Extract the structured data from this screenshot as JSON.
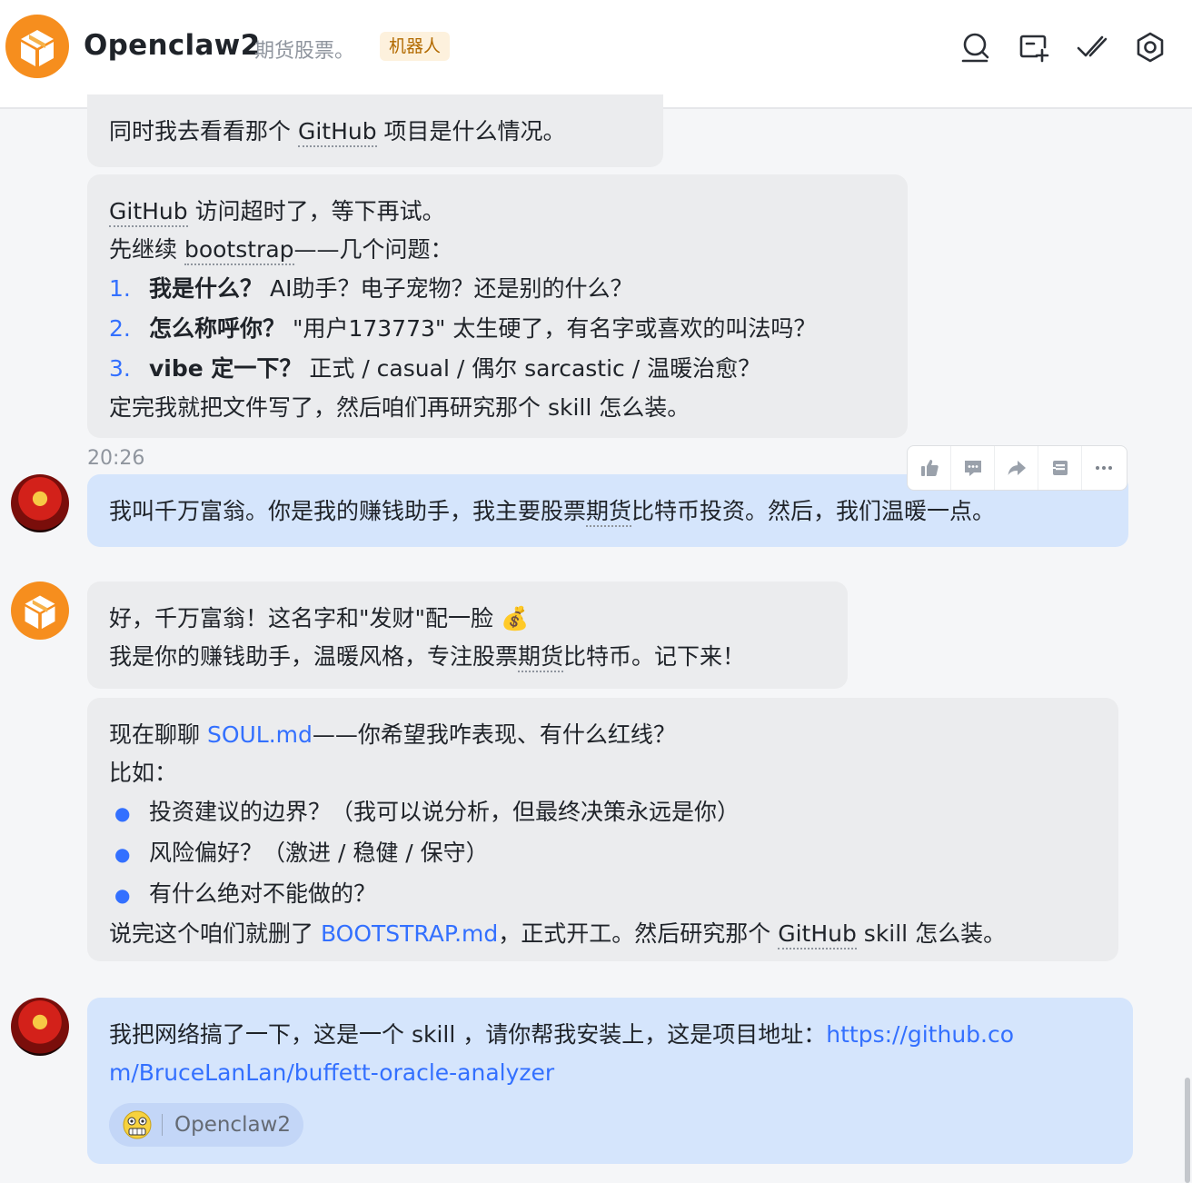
{
  "header": {
    "title": "Openclaw2",
    "subtitle": "期货股票。",
    "badge": "机器人",
    "icons": [
      "search-icon",
      "add-screen-icon",
      "done-check-icon",
      "settings-gear-icon"
    ]
  },
  "messages": {
    "m1": {
      "line1_a": "同时我去看看那个 ",
      "line1_link": "GitHub",
      "line1_b": " 项目是什么情况。"
    },
    "m2": {
      "line1_link": "GitHub",
      "line1_b": " 访问超时了，等下再试。",
      "line2_a": "先继续 ",
      "line2_link": "bootstrap",
      "line2_b": "——几个问题：",
      "items": [
        {
          "num": "1.",
          "bold": "我是什么？",
          "text": "  AI助手？电子宠物？还是别的什么？"
        },
        {
          "num": "2.",
          "bold": "怎么称呼你？",
          "text": "  \"用户173773\" 太生硬了，有名字或喜欢的叫法吗？"
        },
        {
          "num": "3.",
          "bold": "vibe 定一下？",
          "text": "  正式 / casual / 偶尔 sarcastic / 温暖治愈？"
        }
      ],
      "closing": "定完我就把文件写了，然后咱们再研究那个 skill 怎么装。"
    },
    "timestamp": "20:26",
    "m3": {
      "text_a": "我叫千万富翁。你是我的赚钱助手，我主要股票",
      "text_link": "期货",
      "text_b": "比特币投资。然后，我们温暖一点。"
    },
    "m4": {
      "line1": "好，千万富翁！这名字和\"发财\"配一脸 💰",
      "line2_a": "我是你的赚钱助手，温暖风格，专注股票",
      "line2_link": "期货",
      "line2_b": "比特币。记下来！"
    },
    "m5": {
      "line1_a": "现在聊聊 ",
      "line1_link": "SOUL.md",
      "line1_b": "——你希望我咋表现、有什么红线？",
      "line2": "比如：",
      "bullets": [
        "投资建议的边界？（我可以说分析，但最终决策永远是你）",
        "风险偏好？（激进 / 稳健 / 保守）",
        "有什么绝对不能做的？"
      ],
      "closing_a": "说完这个咱们就删了 ",
      "closing_link": "BOOTSTRAP.md",
      "closing_b": "，正式开工。然后研究那个 ",
      "closing_link2": "GitHub",
      "closing_c": " skill 怎么装。"
    },
    "m6": {
      "text_a": "我把网络搞了一下，这是一个 skill ，请你帮我安装上，这是项目地址：",
      "url_part1": "https://github.co",
      "url_part2": "m/BruceLanLan/buffett-oracle-analyzer",
      "mention": "Openclaw2"
    }
  },
  "toolbar": [
    "thumbs-up-icon",
    "comment-icon",
    "forward-icon",
    "archive-icon",
    "more-icon"
  ]
}
